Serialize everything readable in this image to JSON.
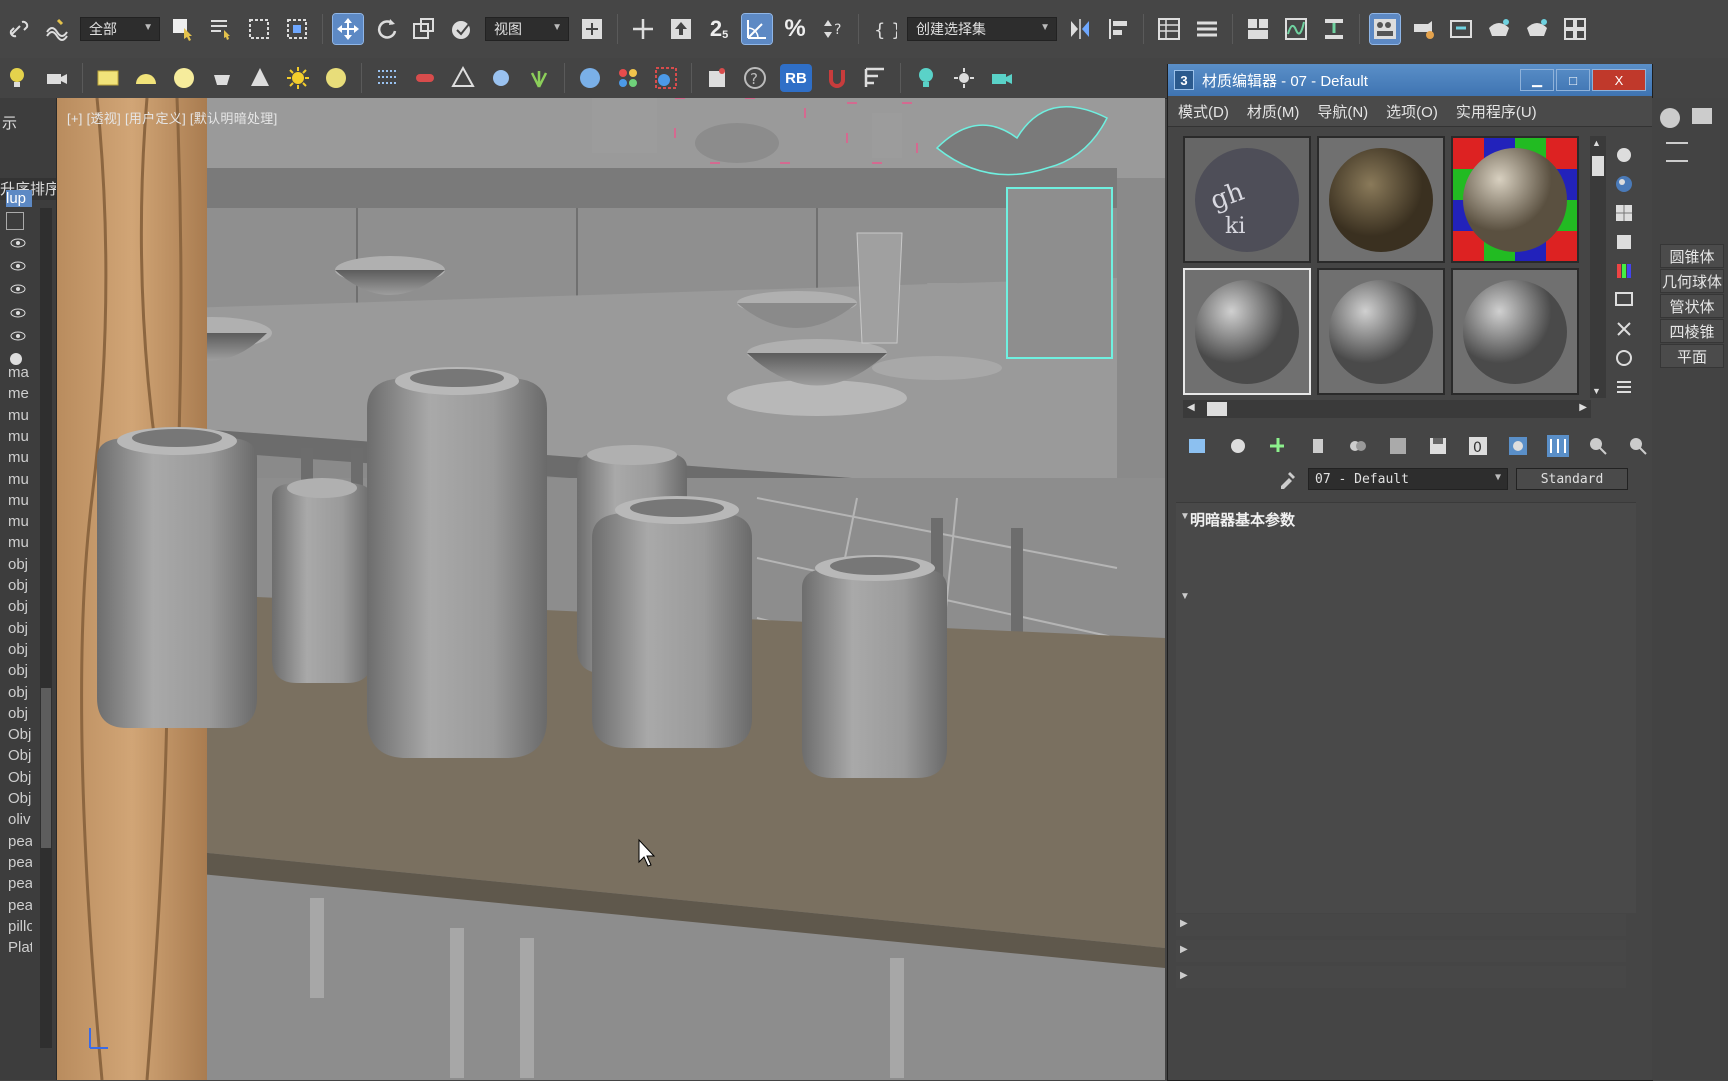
{
  "toolbar_main": {
    "selection_filter": "全部",
    "ref_coord": "视图",
    "named_selection": "创建选择集",
    "rb_label": "RB",
    "snap_label": "2",
    "snap_sub": "5"
  },
  "left_panel": {
    "title": "示",
    "sort_label": "升序排序",
    "selected_item": "lup",
    "items": [
      "ma",
      "me",
      "mu",
      "mu",
      "mu",
      "mu",
      "mu",
      "mu",
      "mu",
      "obj",
      "obj",
      "obj",
      "obj",
      "obj",
      "obj",
      "obj",
      "obj",
      "Obj",
      "Obj",
      "Obj",
      "Obj",
      "oliv",
      "pea",
      "pea",
      "pea",
      "pea",
      "pillo",
      "Plat"
    ]
  },
  "viewport": {
    "label": "[+] [透视] [用户定义] [默认明暗处理]"
  },
  "material_editor": {
    "app_icon": "3",
    "title": "材质编辑器 - 07 - Default",
    "menu": [
      "模式(D)",
      "材质(M)",
      "导航(N)",
      "选项(O)",
      "实用程序(U)"
    ],
    "material_name": "07 - Default",
    "material_type": "Standard",
    "rollup_header": "明暗器基本参数",
    "window_buttons": {
      "minimize": "▁",
      "maximize": "□",
      "close": "X"
    }
  },
  "right_panel": {
    "buttons": [
      "圆锥体",
      "几何球体",
      "管状体",
      "四棱锥",
      "平面"
    ]
  },
  "colors": {
    "accent_blue": "#5d89c4",
    "title_bar": "#4a80bd",
    "toolbar": "#464646",
    "viewport_gray": "#7d7d7d",
    "shelf_brown": "#7a7060"
  },
  "icons": {
    "toolbar": [
      "link-icon",
      "bind-space-warp-icon",
      "select-object-icon",
      "select-by-name-icon",
      "rect-selection-icon",
      "window-crossing-icon",
      "move-icon",
      "rotate-icon",
      "scale-icon",
      "place-icon",
      "use-pivot-icon",
      "keyboard-shortcut-icon",
      "snap-toggle-icon",
      "angle-snap-icon",
      "percent-snap-icon",
      "spinner-snap-icon",
      "edit-named-selection-icon",
      "mirror-icon",
      "align-icon",
      "scene-explorer-icon",
      "layer-explorer-icon",
      "ribbon-icon",
      "curve-editor-icon",
      "schematic-view-icon",
      "material-editor-icon",
      "render-setup-icon",
      "rendered-frame-icon",
      "render-icon",
      "render-production-icon",
      "viewport-layout-icon"
    ]
  }
}
